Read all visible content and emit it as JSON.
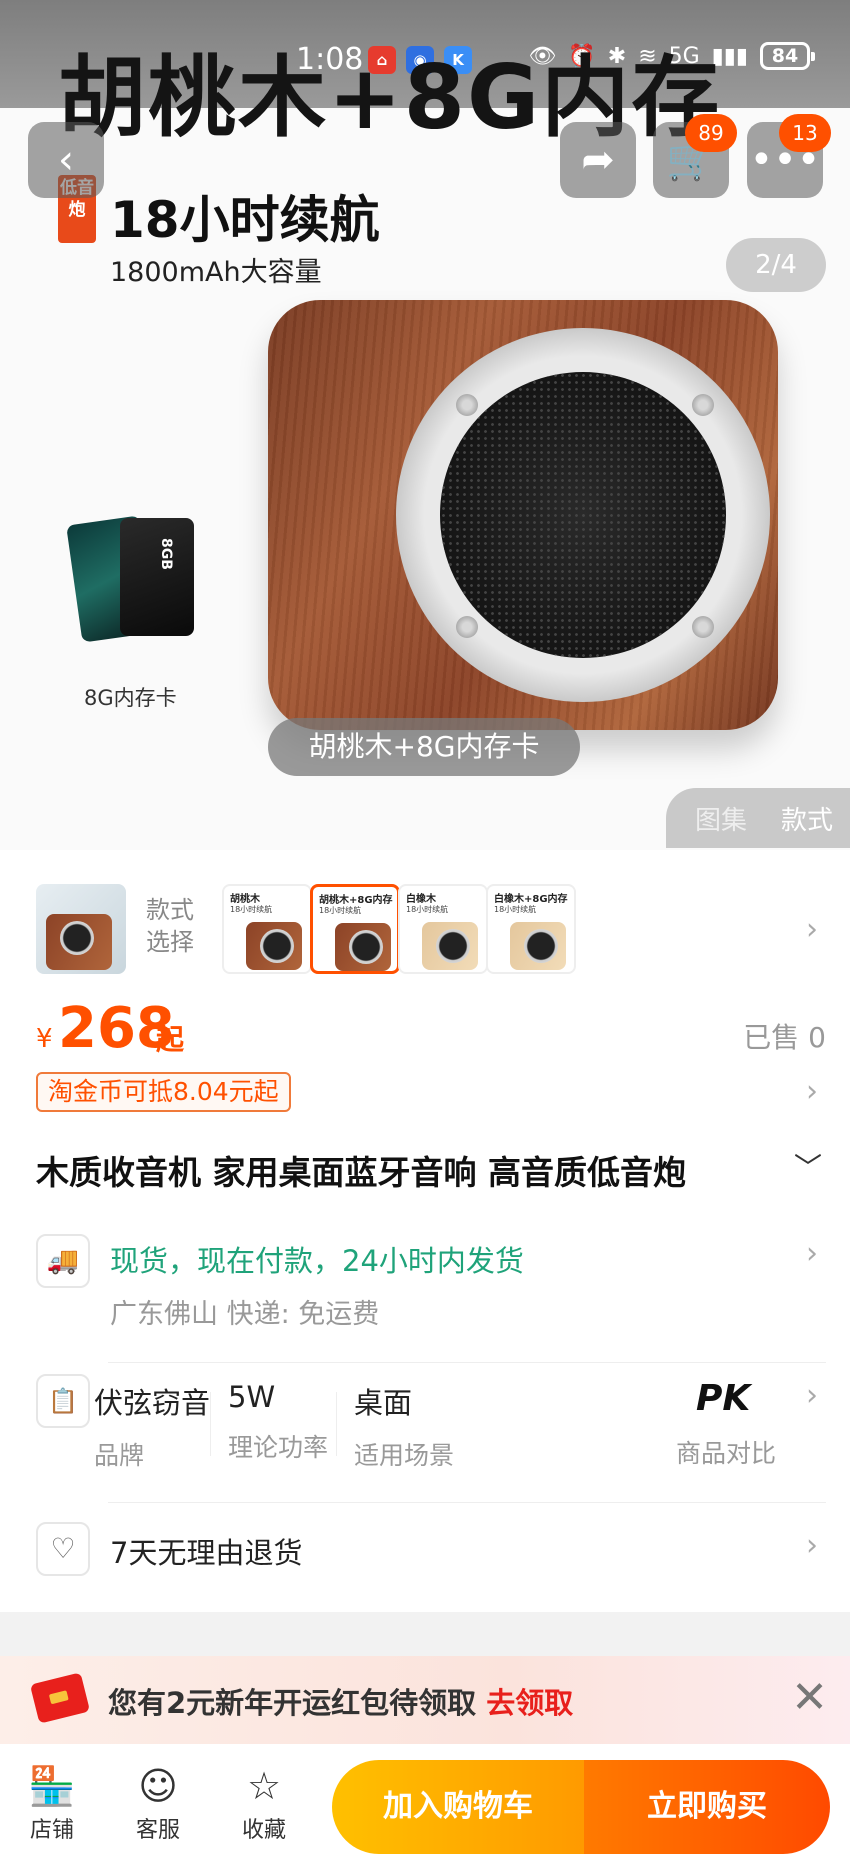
{
  "status_bar": {
    "time": "1:08",
    "battery": "84",
    "network": "5G",
    "apps": [
      {
        "icon": "shopping-app-icon",
        "color": "#e63b2e"
      },
      {
        "icon": "blue-app-icon",
        "color": "#2f6fe0"
      },
      {
        "icon": "k-app-icon",
        "color": "#3a8ef6",
        "glyph": "K"
      }
    ]
  },
  "hero": {
    "overlay_title": "胡桃木+8G内存",
    "promo_tag": "低音炮",
    "promo_headline": "18小时续航",
    "promo_sub": "1800mAh大容量",
    "image_counter": "2/4",
    "sd_card_caption": "8G内存卡",
    "sd_card_text": "8GB",
    "variant_label": "胡桃木+8G内存卡",
    "media_tabs": [
      "图集",
      "款式"
    ],
    "active_media_tab": "款式"
  },
  "nav": {
    "cart_count": "89",
    "more_count": "13"
  },
  "style_picker": {
    "label": "款式选择",
    "thumbs": [
      {
        "title": "胡桃木",
        "sub": "18小时续航",
        "wood": "walnut",
        "selected": false
      },
      {
        "title": "胡桃木+8G内存",
        "sub": "18小时续航",
        "wood": "walnut",
        "selected": true
      },
      {
        "title": "白橡木",
        "sub": "18小时续航",
        "wood": "oak",
        "selected": false
      },
      {
        "title": "白橡木+8G内存",
        "sub": "18小时续航",
        "wood": "oak",
        "selected": false
      }
    ]
  },
  "price": {
    "symbol": "¥",
    "value": "268",
    "suffix": "起",
    "sold": "已售 0",
    "coin_offer": "淘金币可抵8.04元起"
  },
  "product": {
    "title": "木质收音机 家用桌面蓝牙音响 高音质低音炮"
  },
  "shipping": {
    "main": "现货，现在付款，24小时内发货",
    "sub": "广东佛山  快递: 免运费"
  },
  "specs": [
    {
      "value": "伏弦窃音",
      "key": "品牌"
    },
    {
      "value": "5W",
      "key": "理论功率"
    },
    {
      "value": "桌面",
      "key": "适用场景"
    }
  ],
  "compare": {
    "logo": "PK",
    "label": "商品对比"
  },
  "returns": {
    "text": "7天无理由退货"
  },
  "coupon": {
    "text": "您有2元新年开运红包待领取",
    "cta": "去领取"
  },
  "bottom_bar": {
    "store": "店铺",
    "service": "客服",
    "favorite": "收藏",
    "add_to_cart": "加入购物车",
    "buy_now": "立即购买"
  },
  "colors": {
    "accent": "#ff5000",
    "shipping_green": "#1fa37a",
    "cart_button": "#ffb000",
    "buy_button": "#ff5a00"
  }
}
